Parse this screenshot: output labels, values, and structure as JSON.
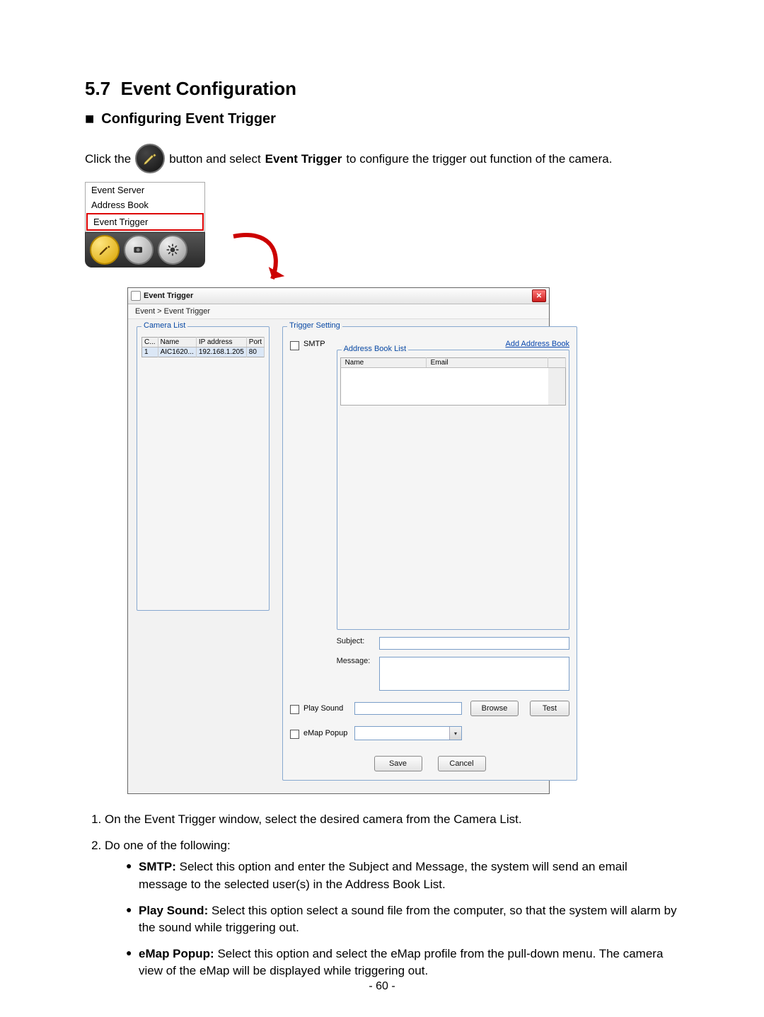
{
  "section": {
    "number": "5.7",
    "title": "Event Configuration"
  },
  "subsection": {
    "bullet": "■",
    "title": "Configuring Event Trigger"
  },
  "intro": {
    "pre": "Click the",
    "mid1": "button and select",
    "bold": "Event Trigger",
    "post": "to configure the trigger out function of the camera."
  },
  "menu": {
    "items": [
      "Event Server",
      "Address Book",
      "Event Trigger"
    ],
    "highlighted_index": 2
  },
  "toolbar_icons": [
    "pen-icon",
    "camera-icon",
    "gear-icon"
  ],
  "dialog": {
    "title": "Event Trigger",
    "breadcrumb": "Event > Event Trigger",
    "camera_list": {
      "legend": "Camera List",
      "headers": [
        "C...",
        "Name",
        "IP address",
        "Port"
      ],
      "rows": [
        [
          "1",
          "AIC1620...",
          "192.168.1.205",
          "80"
        ]
      ]
    },
    "trigger": {
      "legend": "Trigger Setting",
      "smtp_label": "SMTP",
      "add_address_book": "Add Address Book",
      "addr_legend": "Address Book List",
      "addr_headers": [
        "Name",
        "Email"
      ],
      "subject_label": "Subject:",
      "message_label": "Message:",
      "play_sound_label": "Play Sound",
      "browse_btn": "Browse",
      "test_btn": "Test",
      "emap_label": "eMap Popup",
      "save_btn": "Save",
      "cancel_btn": "Cancel"
    }
  },
  "steps": {
    "s1": "On the Event Trigger window, select the desired camera from the Camera List.",
    "s2": "Do one of the following:",
    "smtp_bold": "SMTP:",
    "smtp_rest": " Select this option and enter the Subject and Message, the system will send an email message to the selected user(s) in the Address Book List.",
    "ps_bold": "Play Sound:",
    "ps_rest": " Select this option select a sound file from the computer, so that the system will alarm by the sound while triggering out.",
    "em_bold": "eMap Popup:",
    "em_rest": " Select this option and select the eMap profile from the pull-down menu. The camera view of the eMap will be displayed while triggering out."
  },
  "page_number": "- 60 -"
}
